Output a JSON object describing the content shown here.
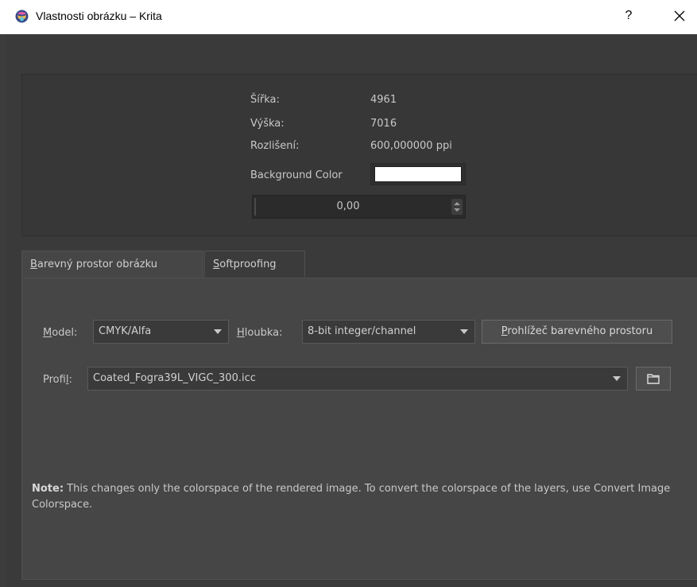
{
  "window": {
    "title": "Vlastnosti obrázku – Krita",
    "help_label": "?",
    "close_icon": "close-icon",
    "app_icon": "krita-icon"
  },
  "info": {
    "width_label": "Šířka:",
    "width_value": "4961",
    "height_label": "Výška:",
    "height_value": "7016",
    "resolution_label": "Rozlišení:",
    "resolution_value": "600,000000 ppi",
    "background_label": "Background Color",
    "background_color": "#ffffff",
    "opacity_value": "0,00"
  },
  "tabs": [
    {
      "mnemonic": "B",
      "rest": "arevný prostor obrázku",
      "active": true
    },
    {
      "mnemonic": "S",
      "rest": "oftproofing",
      "active": false
    }
  ],
  "colorspace": {
    "model_mnemonic": "M",
    "model_rest": "odel:",
    "model_value": "CMYK/Alfa",
    "depth_mnemonic": "H",
    "depth_rest": "loubka:",
    "depth_value": "8-bit integer/channel",
    "browser_mnemonic": "P",
    "browser_rest": "rohlížeč barevného prostoru",
    "profile_pre": "Profi",
    "profile_mnemonic": "l",
    "profile_post": ":",
    "profile_value": "Coated_Fogra39L_VIGC_300.icc",
    "folder_icon": "folder-icon"
  },
  "note": {
    "bold": "Note:",
    "text": " This changes only the colorspace of the rendered image. To convert the colorspace of the layers, use Convert Image Colorspace."
  },
  "colors": {
    "titlebar": "#ffffff",
    "dialog_bg": "#3a3a3a",
    "tab_pane": "#464646"
  }
}
